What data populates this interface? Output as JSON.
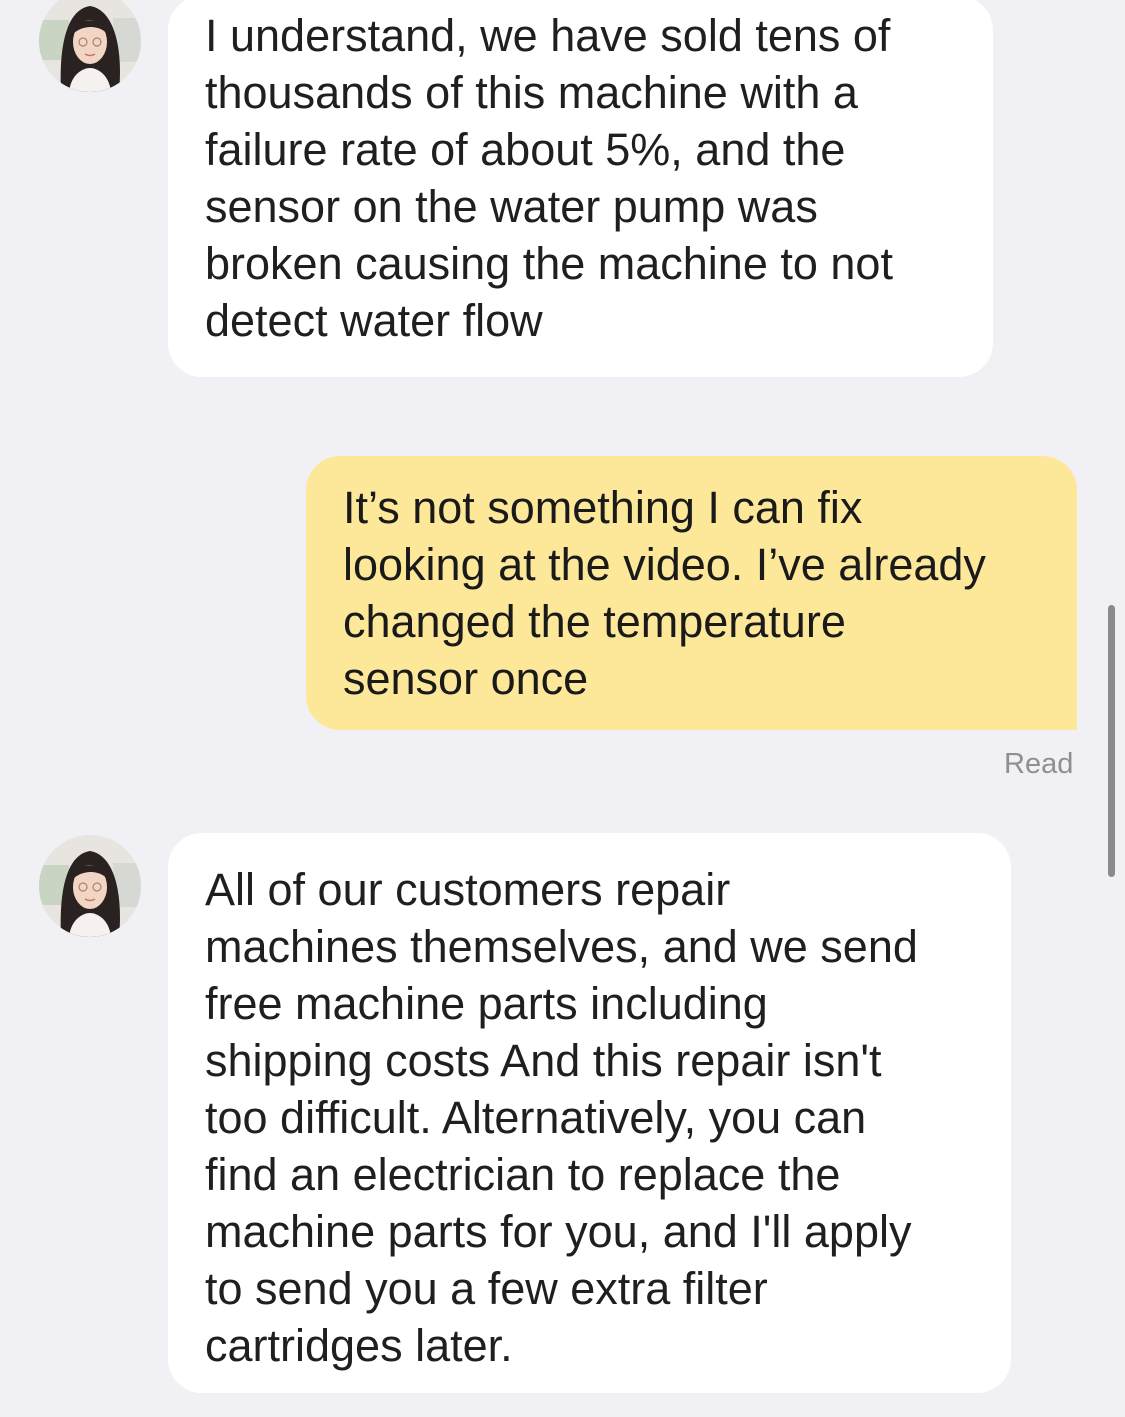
{
  "messages": [
    {
      "sender": "contact",
      "avatar_icon": "contact-avatar",
      "text": "I understand, we have sold tens of\nthousands of this machine with a\nfailure rate of about 5%, and the\nsensor on the water pump was\nbroken causing the machine to not\ndetect water flow"
    },
    {
      "sender": "me",
      "text": "It’s not something I can fix\nlooking at the video. I’ve already\nchanged the temperature\nsensor once",
      "status": "Read"
    },
    {
      "sender": "contact",
      "avatar_icon": "contact-avatar",
      "text": "All of our customers repair\nmachines themselves, and we send\nfree machine parts including\nshipping costs And this repair isn't\ntoo difficult. Alternatively, you can\nfind an electrician to replace the\nmachine parts for you, and I'll apply\nto send you a few extra filter\ncartridges later."
    }
  ],
  "colors": {
    "background": "#f1f1f5",
    "incoming_bubble": "#ffffff",
    "outgoing_bubble": "#fde89a",
    "read_receipt": "#8e8e93"
  }
}
